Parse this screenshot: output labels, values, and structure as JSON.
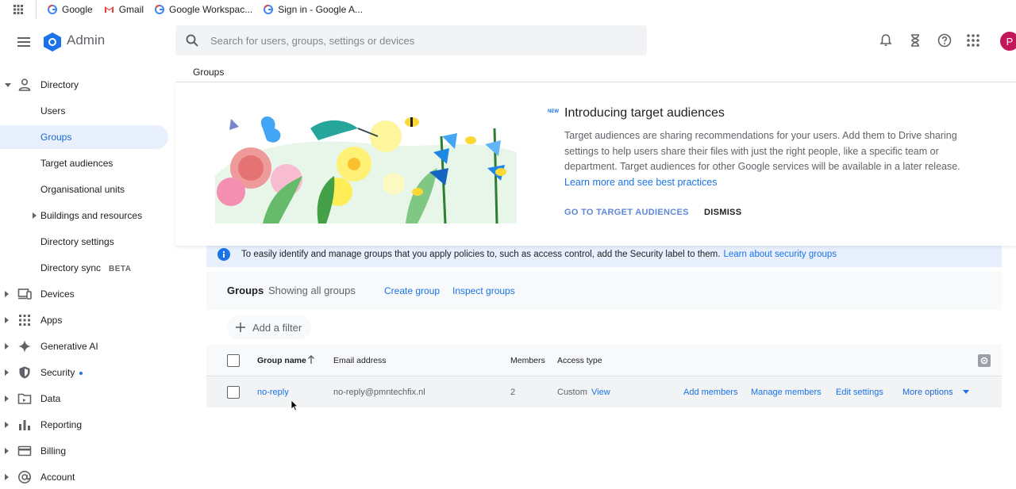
{
  "bookmarks": [
    {
      "label": "Google"
    },
    {
      "label": "Gmail"
    },
    {
      "label": "Google Workspac..."
    },
    {
      "label": "Sign in - Google A..."
    }
  ],
  "header": {
    "app_name": "Admin",
    "search_placeholder": "Search for users, groups, settings or devices",
    "avatar_letter": "P"
  },
  "breadcrumb": "Groups",
  "sidebar": {
    "directory": "Directory",
    "sub": [
      "Users",
      "Groups",
      "Target audiences",
      "Organisational units",
      "Buildings and resources",
      "Directory settings",
      "Directory sync"
    ],
    "beta": "BETA",
    "sections": [
      "Devices",
      "Apps",
      "Generative AI",
      "Security",
      "Data",
      "Reporting",
      "Billing",
      "Account"
    ]
  },
  "promo": {
    "badge": "NEW",
    "title": "Introducing target audiences",
    "text": "Target audiences are sharing recommendations for your users. Add them to Drive sharing settings to help users share their files with just the right people, like a specific team or department. Target audiences for other Google services will be available in a later release.",
    "link": "Learn more and see best practices",
    "go_button": "GO TO TARGET AUDIENCES",
    "dismiss_button": "DISMISS"
  },
  "info_banner": {
    "text": "To easily identify and manage groups that you apply policies to, such as access control, add the Security label to them.",
    "link": "Learn about security groups"
  },
  "groups_panel": {
    "title": "Groups",
    "subtitle": "Showing all groups",
    "create_link": "Create group",
    "inspect_link": "Inspect groups",
    "add_filter": "Add a filter",
    "columns": [
      "Group name",
      "Email address",
      "Members",
      "Access type"
    ],
    "rows": [
      {
        "name": "no-reply",
        "email": "no-reply@pmntechfix.nl",
        "members": "2",
        "access": "Custom",
        "view": "View",
        "actions": [
          "Add members",
          "Manage members",
          "Edit settings",
          "More options"
        ]
      }
    ]
  },
  "colors": {
    "accent": "#1a73e8",
    "active_bg": "#e8f0fe",
    "avatar": "#c2185b"
  }
}
